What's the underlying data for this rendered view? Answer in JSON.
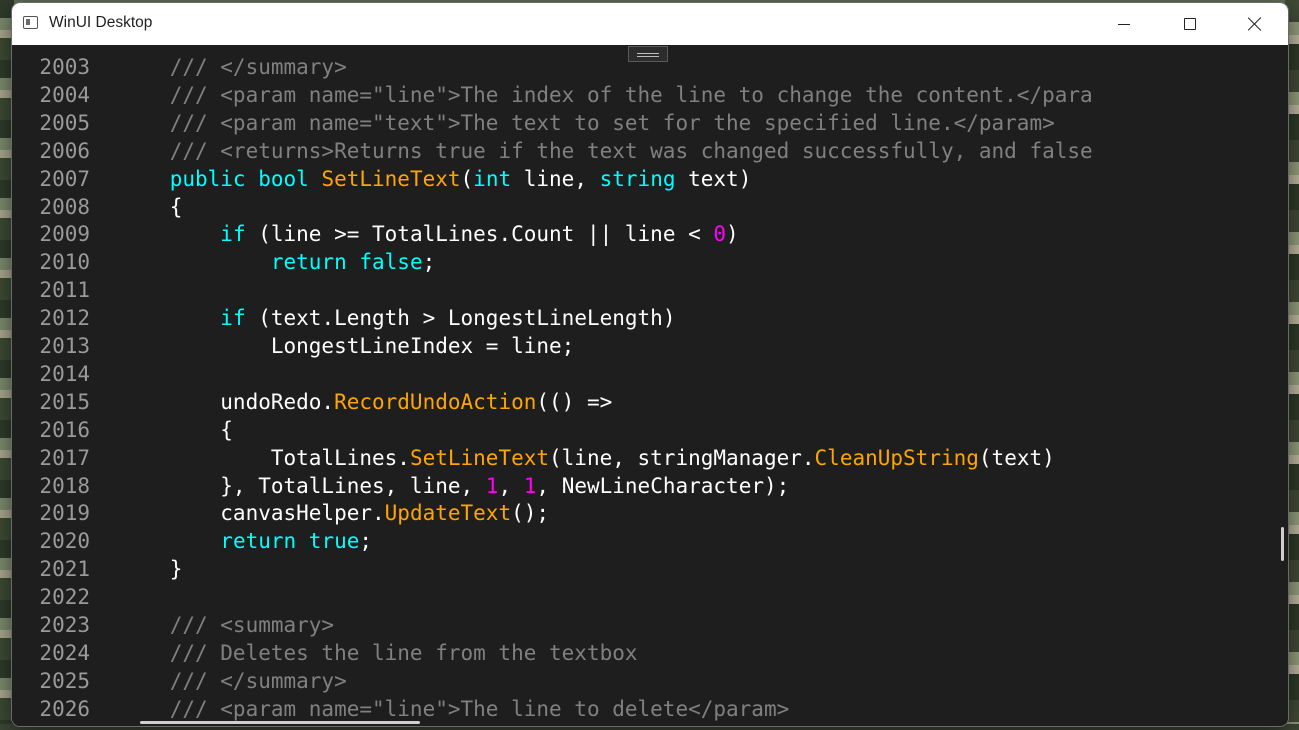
{
  "window": {
    "title": "WinUI Desktop",
    "minimize_icon": "minimize-icon",
    "maximize_icon": "maximize-icon",
    "close_icon": "close-icon"
  },
  "colors": {
    "comment": "#808080",
    "keyword": "#00ffff",
    "method": "#ffa500",
    "number": "#ff00ff",
    "default": "#ffffff",
    "line_number": "#9a9a9a",
    "background": "#1e1e1e"
  },
  "editor": {
    "lines": [
      {
        "number": "2003",
        "tokens": [
          [
            "comment",
            "            /// </summary>"
          ]
        ]
      },
      {
        "number": "2004",
        "tokens": [
          [
            "comment",
            "            /// <param name=\"line\">The index of the line to change the content.</para"
          ]
        ]
      },
      {
        "number": "2005",
        "tokens": [
          [
            "comment",
            "            /// <param name=\"text\">The text to set for the specified line.</param>"
          ]
        ]
      },
      {
        "number": "2006",
        "tokens": [
          [
            "comment",
            "            /// <returns>Returns true if the text was changed successfully, and false"
          ]
        ]
      },
      {
        "number": "2007",
        "tokens": [
          [
            "default",
            "            "
          ],
          [
            "keyword",
            "public bool "
          ],
          [
            "method",
            "SetLineText"
          ],
          [
            "default",
            "("
          ],
          [
            "keyword",
            "int"
          ],
          [
            "default",
            " line, "
          ],
          [
            "keyword",
            "string"
          ],
          [
            "default",
            " text)"
          ]
        ]
      },
      {
        "number": "2008",
        "tokens": [
          [
            "default",
            "            {"
          ]
        ]
      },
      {
        "number": "2009",
        "tokens": [
          [
            "default",
            "                "
          ],
          [
            "keyword",
            "if"
          ],
          [
            "default",
            " (line >= TotalLines.Count || line < "
          ],
          [
            "number",
            "0"
          ],
          [
            "default",
            ")"
          ]
        ]
      },
      {
        "number": "2010",
        "tokens": [
          [
            "default",
            "                    "
          ],
          [
            "keyword",
            "return false"
          ],
          [
            "default",
            ";"
          ]
        ]
      },
      {
        "number": "2011",
        "tokens": []
      },
      {
        "number": "2012",
        "tokens": [
          [
            "default",
            "                "
          ],
          [
            "keyword",
            "if"
          ],
          [
            "default",
            " (text.Length > LongestLineLength)"
          ]
        ]
      },
      {
        "number": "2013",
        "tokens": [
          [
            "default",
            "                    LongestLineIndex = line;"
          ]
        ]
      },
      {
        "number": "2014",
        "tokens": []
      },
      {
        "number": "2015",
        "tokens": [
          [
            "default",
            "                undoRedo."
          ],
          [
            "method",
            "RecordUndoAction"
          ],
          [
            "default",
            "(() =>"
          ]
        ]
      },
      {
        "number": "2016",
        "tokens": [
          [
            "default",
            "                {"
          ]
        ]
      },
      {
        "number": "2017",
        "tokens": [
          [
            "default",
            "                    TotalLines."
          ],
          [
            "method",
            "SetLineText"
          ],
          [
            "default",
            "(line, stringManager."
          ],
          [
            "method",
            "CleanUpString"
          ],
          [
            "default",
            "(text)"
          ]
        ]
      },
      {
        "number": "2018",
        "tokens": [
          [
            "default",
            "                }, TotalLines, line, "
          ],
          [
            "number",
            "1"
          ],
          [
            "default",
            ", "
          ],
          [
            "number",
            "1"
          ],
          [
            "default",
            ", NewLineCharacter);"
          ]
        ]
      },
      {
        "number": "2019",
        "tokens": [
          [
            "default",
            "                canvasHelper."
          ],
          [
            "method",
            "UpdateText"
          ],
          [
            "default",
            "();"
          ]
        ]
      },
      {
        "number": "2020",
        "tokens": [
          [
            "default",
            "                "
          ],
          [
            "keyword",
            "return true"
          ],
          [
            "default",
            ";"
          ]
        ]
      },
      {
        "number": "2021",
        "tokens": [
          [
            "default",
            "            }"
          ]
        ]
      },
      {
        "number": "2022",
        "tokens": []
      },
      {
        "number": "2023",
        "tokens": [
          [
            "comment",
            "            /// <summary>"
          ]
        ]
      },
      {
        "number": "2024",
        "tokens": [
          [
            "comment",
            "            /// Deletes the line from the textbox"
          ]
        ]
      },
      {
        "number": "2025",
        "tokens": [
          [
            "comment",
            "            /// </summary>"
          ]
        ]
      },
      {
        "number": "2026",
        "tokens": [
          [
            "comment",
            "            /// <param name=\"line\">The line to delete</param>"
          ]
        ]
      }
    ]
  }
}
